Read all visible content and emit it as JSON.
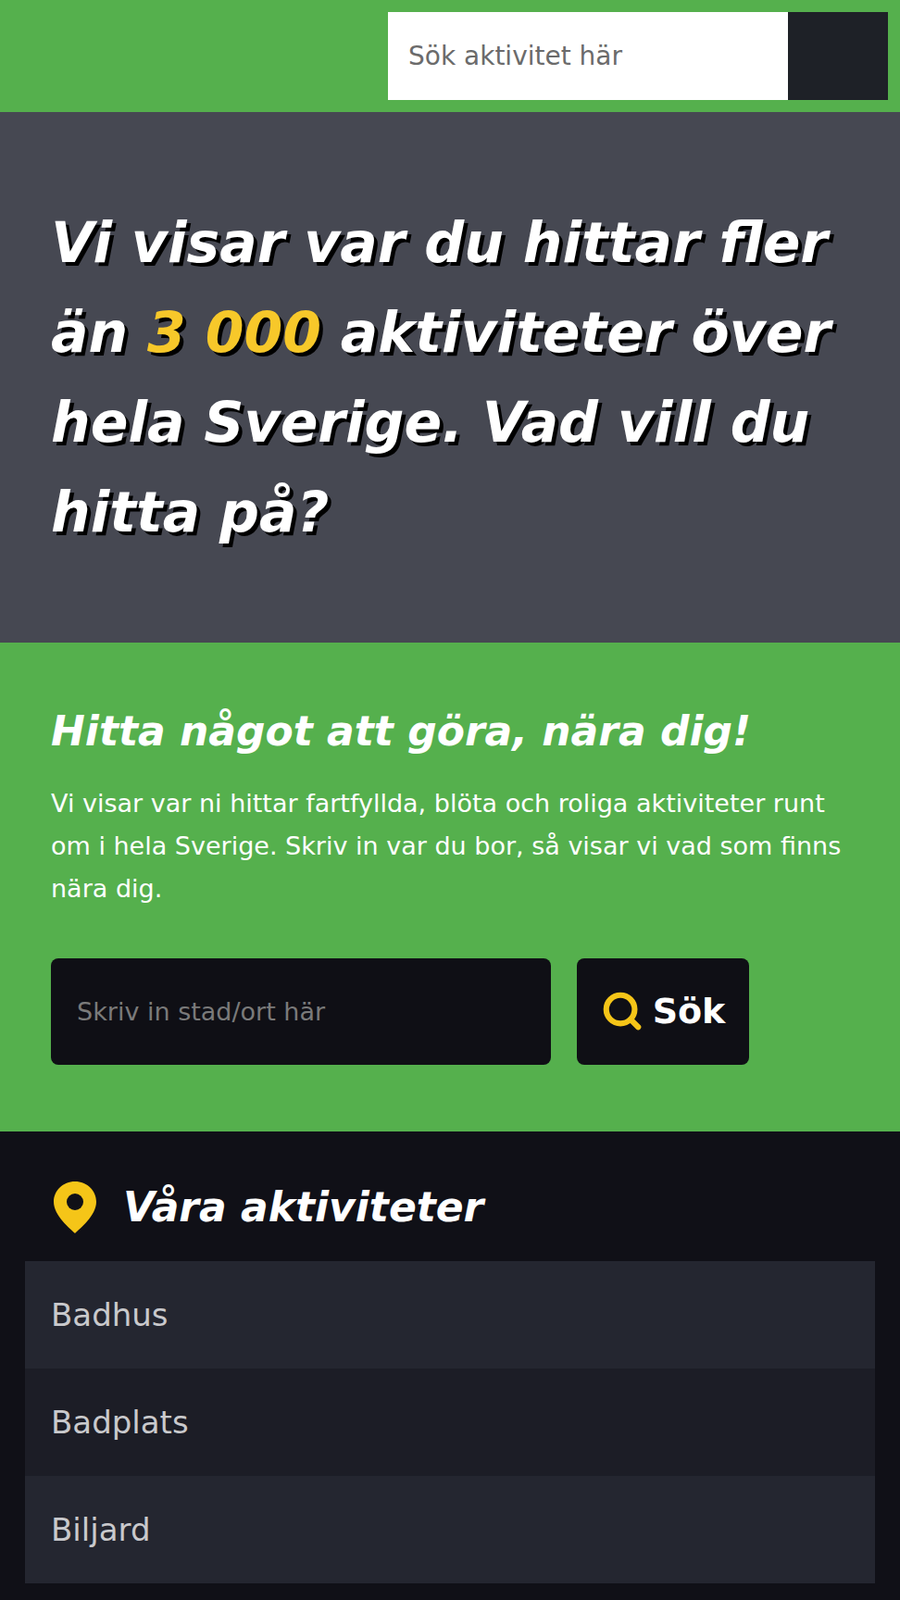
{
  "header": {
    "search": {
      "placeholder": "Sök aktivitet här"
    }
  },
  "hero": {
    "text_before": "Vi visar var du hittar fler än ",
    "highlight": "3 000",
    "text_after": " aktiviteter över hela Sverige. Vad vill du hitta på?"
  },
  "intro": {
    "title": "Hitta något att göra, nära dig!",
    "text": "Vi visar var ni hittar fartfyllda, blöta och roliga aktiviteter runt om i hela Sverige. Skriv in var du bor, så visar vi vad som finns nära dig.",
    "search": {
      "placeholder": "Skriv in stad/ort här",
      "button": "Sök"
    }
  },
  "activities": {
    "title": "Våra aktiviteter",
    "items": [
      {
        "label": "Badhus"
      },
      {
        "label": "Badplats"
      },
      {
        "label": "Biljard"
      }
    ]
  }
}
